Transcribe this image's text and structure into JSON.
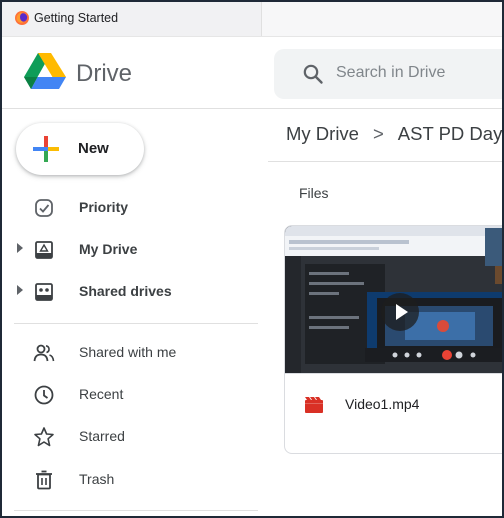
{
  "window": {
    "title": "Getting Started",
    "icon": "firefox-icon"
  },
  "header": {
    "brand": "Drive",
    "search_placeholder": "Search in Drive"
  },
  "sidebar": {
    "new_label": "New",
    "items": [
      {
        "label": "Priority",
        "icon": "priority-icon",
        "has_caret": false
      },
      {
        "label": "My Drive",
        "icon": "my-drive-icon",
        "has_caret": true
      },
      {
        "label": "Shared drives",
        "icon": "shared-drives-icon",
        "has_caret": true
      },
      {
        "label": "Shared with me",
        "icon": "shared-with-me-icon",
        "has_caret": false
      },
      {
        "label": "Recent",
        "icon": "clock-icon",
        "has_caret": false
      },
      {
        "label": "Starred",
        "icon": "star-icon",
        "has_caret": false
      },
      {
        "label": "Trash",
        "icon": "trash-icon",
        "has_caret": false
      }
    ]
  },
  "main": {
    "breadcrumb": {
      "root": "My Drive",
      "separator": ">",
      "current": "AST PD Day"
    },
    "section_title": "Files",
    "files": [
      {
        "name": "Video1.mp4",
        "type_icon": "video-file-icon"
      }
    ]
  },
  "colors": {
    "video_icon": "#d93025",
    "text": "#3c4043",
    "search_bg": "#f1f3f4"
  }
}
